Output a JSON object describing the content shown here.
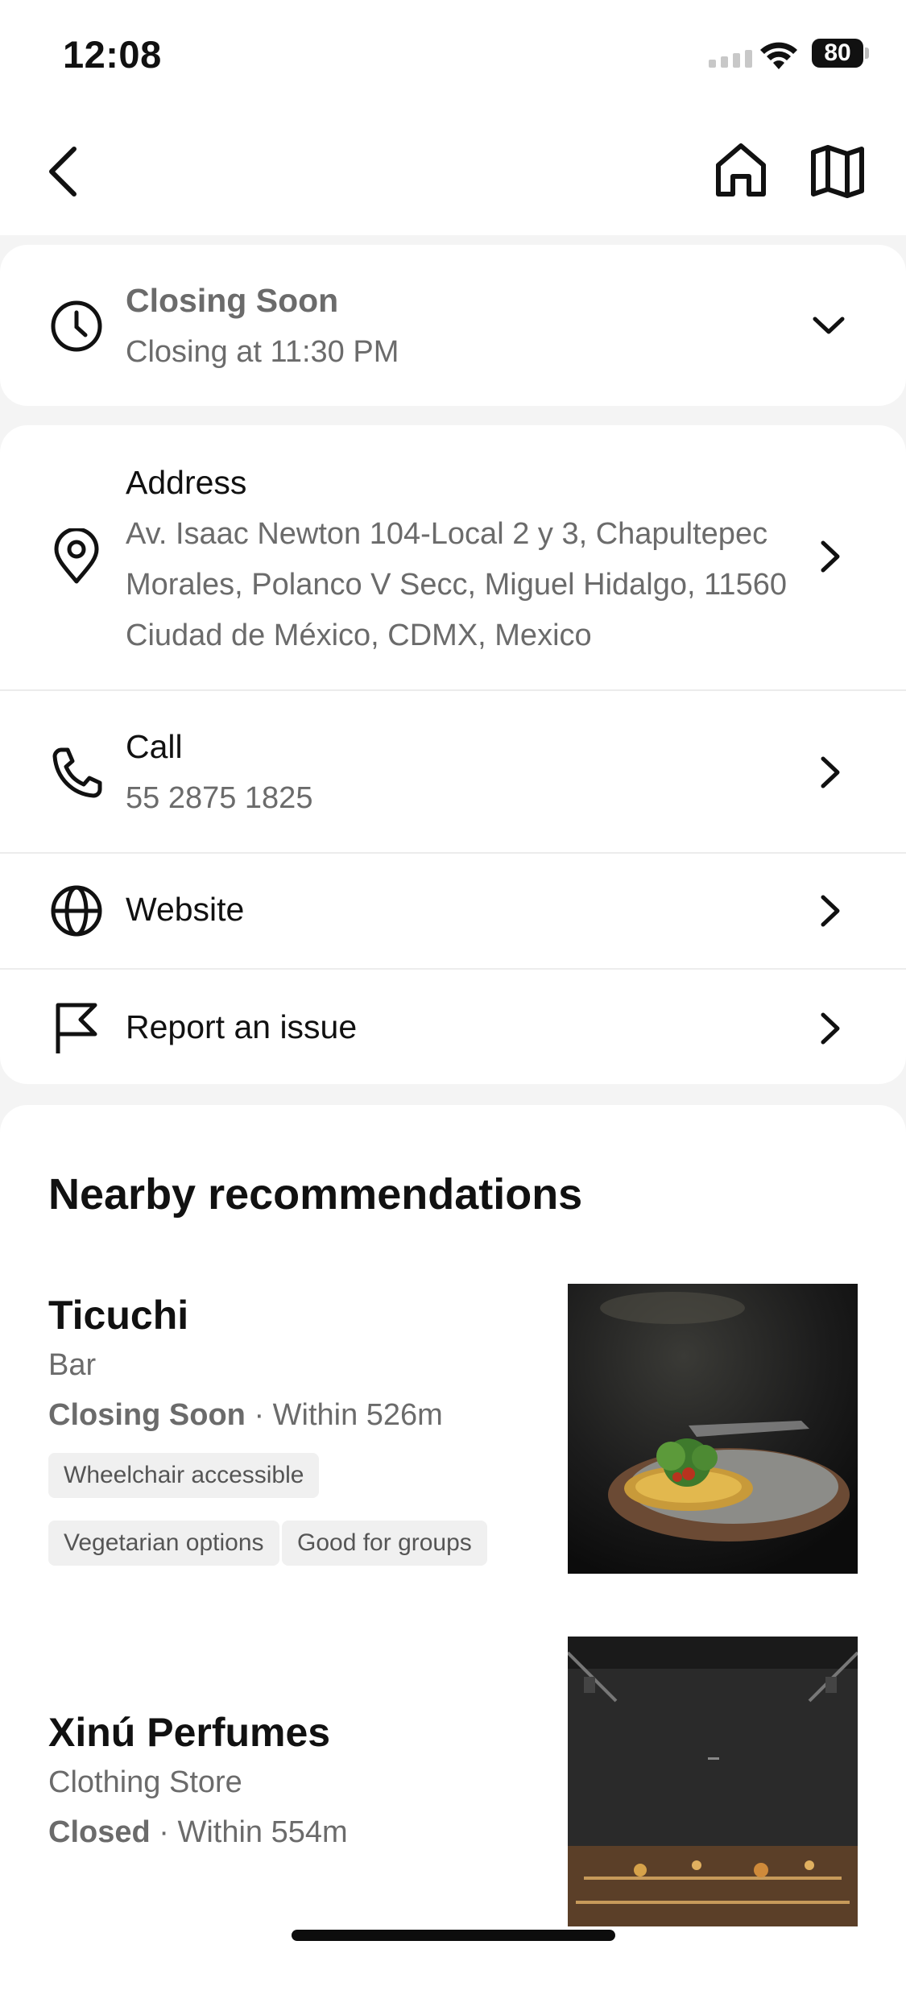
{
  "status_bar": {
    "time": "12:08",
    "battery": "80"
  },
  "hours": {
    "title": "Closing Soon",
    "subtitle": "Closing at 11:30 PM"
  },
  "address": {
    "title": "Address",
    "lines": [
      "Av. Isaac Newton 104-Local 2 y 3, Chapultepec",
      "Morales, Polanco V Secc, Miguel Hidalgo, 11560",
      "Ciudad de México, CDMX, Mexico"
    ]
  },
  "call": {
    "title": "Call",
    "number": "55 2875 1825"
  },
  "website": {
    "title": "Website"
  },
  "report": {
    "title": "Report an issue"
  },
  "nearby": {
    "title": "Nearby recommendations",
    "items": [
      {
        "name": "Ticuchi",
        "category": "Bar",
        "status": "Closing Soon",
        "distance": "· Within 526m",
        "tags": [
          "Wheelchair accessible",
          "Vegetarian options",
          "Good for groups"
        ]
      },
      {
        "name": "Xinú Perfumes",
        "category": "Clothing Store",
        "status": "Closed",
        "distance": "· Within 554m",
        "tags": []
      }
    ]
  }
}
